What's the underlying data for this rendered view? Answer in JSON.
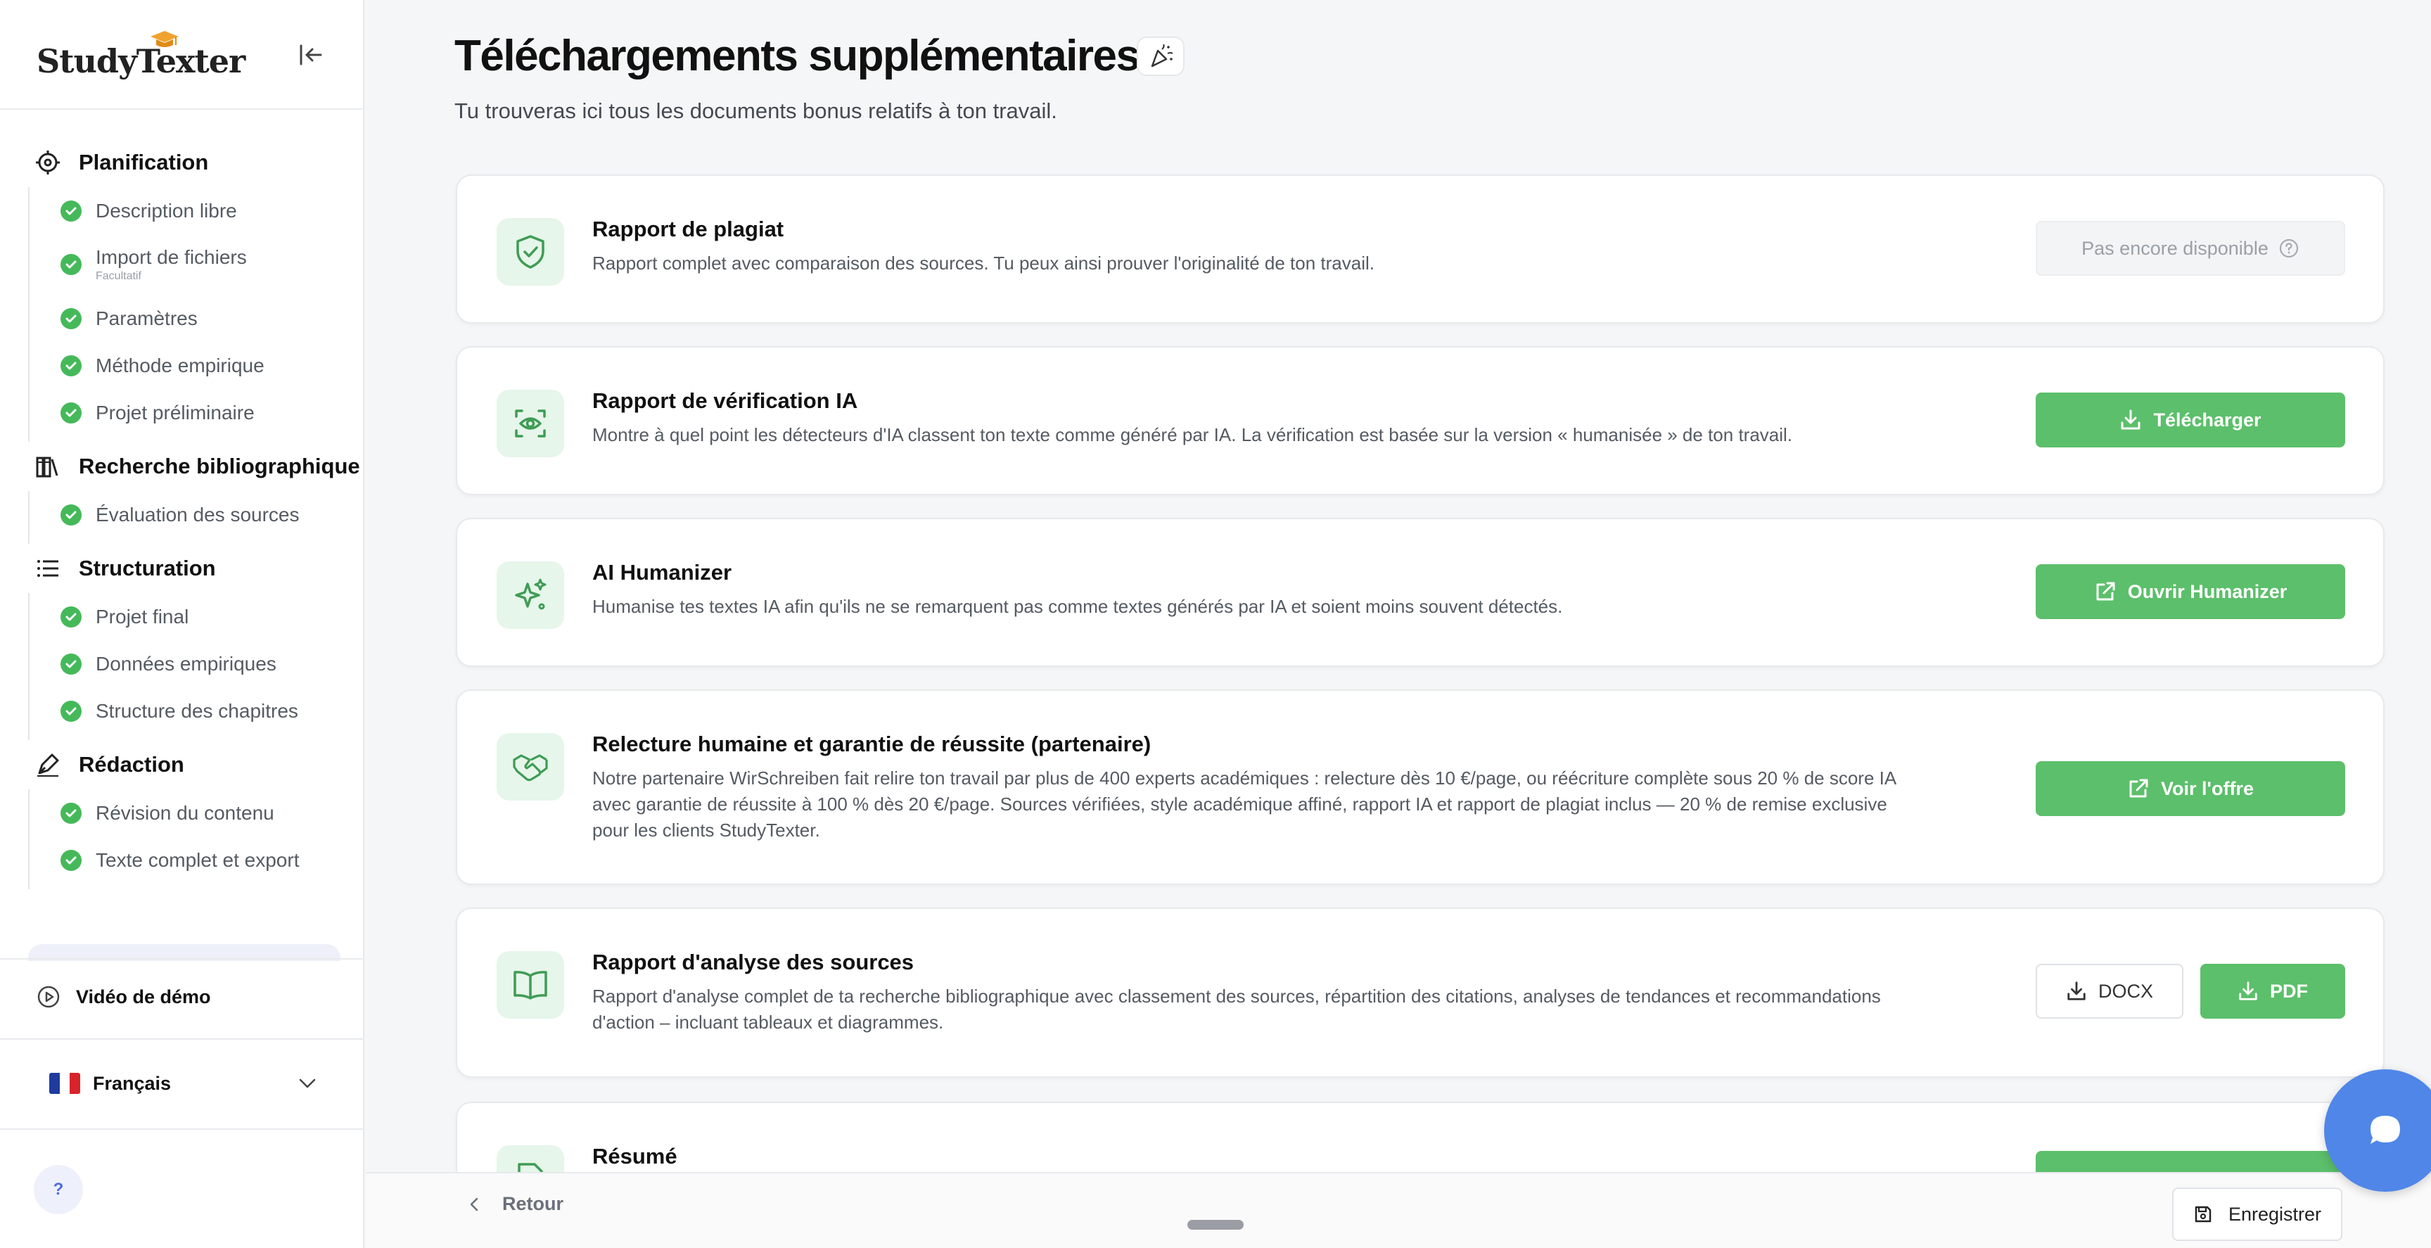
{
  "app": {
    "brand": "StudyTexter"
  },
  "sidebar": {
    "sections": [
      {
        "title": "Planification",
        "icon": "target-icon",
        "items": [
          {
            "label": "Description libre"
          },
          {
            "label": "Import de fichiers",
            "note": "Facultatif"
          },
          {
            "label": "Paramètres"
          },
          {
            "label": "Méthode empirique"
          },
          {
            "label": "Projet préliminaire"
          }
        ]
      },
      {
        "title": "Recherche bibliographique",
        "icon": "books-icon",
        "items": [
          {
            "label": "Évaluation des sources"
          }
        ]
      },
      {
        "title": "Structuration",
        "icon": "list-icon",
        "items": [
          {
            "label": "Projet final"
          },
          {
            "label": "Données empiriques"
          },
          {
            "label": "Structure des chapitres"
          }
        ]
      },
      {
        "title": "Rédaction",
        "icon": "pen-icon",
        "items": [
          {
            "label": "Révision du contenu"
          },
          {
            "label": "Texte complet et export"
          }
        ]
      }
    ],
    "demo_label": "Vidéo de démo",
    "language": "Français",
    "help": "?"
  },
  "main": {
    "title": "Téléchargements supplémentaires",
    "subtitle": "Tu trouveras ici tous les documents bonus relatifs à ton travail.",
    "cards": [
      {
        "title": "Rapport de plagiat",
        "description": "Rapport complet avec comparaison des sources. Tu peux ainsi prouver l'originalité de ton travail.",
        "icon": "shield-check-icon",
        "action": "Pas encore disponible"
      },
      {
        "title": "Rapport de vérification IA",
        "description": "Montre à quel point les détecteurs d'IA classent ton texte comme généré par IA. La vérification est basée sur la version « humanisée » de ton travail.",
        "icon": "eye-scan-icon",
        "action": "Télécharger"
      },
      {
        "title": "AI Humanizer",
        "description": "Humanise tes textes IA afin qu'ils ne se remarquent pas comme textes générés par IA et soient moins souvent détectés.",
        "icon": "sparkles-icon",
        "action": "Ouvrir Humanizer"
      },
      {
        "title": "Relecture humaine et garantie de réussite (partenaire)",
        "description": "Notre partenaire WirSchreiben fait relire ton travail par plus de 400 experts académiques : relecture dès 10 €/page, ou réécriture complète sous 20 % de score IA avec garantie de réussite à 100 % dès 20 €/page. Sources vérifiées, style académique affiné, rapport IA et rapport de plagiat inclus — 20 % de remise exclusive pour les clients StudyTexter.",
        "icon": "handshake-icon",
        "action": "Voir l'offre"
      },
      {
        "title": "Rapport d'analyse des sources",
        "description": "Rapport d'analyse complet de ta recherche bibliographique avec classement des sources, répartition des citations, analyses de tendances et recommandations d'action – incluant tableaux et diagrammes.",
        "icon": "open-book-icon",
        "action_docx": "DOCX",
        "action_pdf": "PDF"
      },
      {
        "title": "Résumé",
        "icon": "file-edit-icon"
      }
    ]
  },
  "footer": {
    "back": "Retour",
    "save": "Enregistrer"
  },
  "colors": {
    "accent": "#5cbf6b",
    "check": "#45b95a",
    "chat": "#4f86e8"
  }
}
